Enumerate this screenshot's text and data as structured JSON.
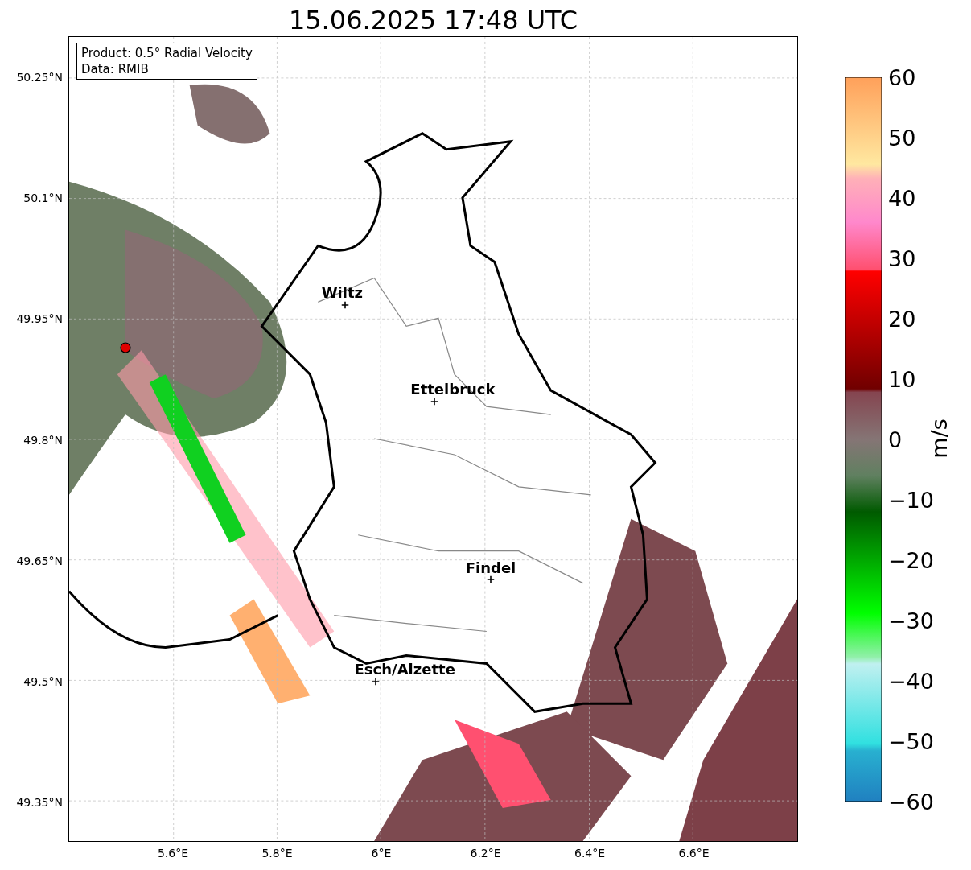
{
  "title": "15.06.2025 17:48 UTC",
  "info_box": {
    "lines": [
      "Product: 0.5° Radial Velocity",
      "Data: RMIB"
    ]
  },
  "map": {
    "cities": [
      {
        "name": "Wiltz"
      },
      {
        "name": "Ettelbruck"
      },
      {
        "name": "Findel"
      },
      {
        "name": "Esch/Alzette"
      }
    ]
  },
  "y_ticks": [
    "50.25°N",
    "50.1°N",
    "49.95°N",
    "49.8°N",
    "49.65°N",
    "49.5°N",
    "49.35°N"
  ],
  "x_ticks": [
    "5.6°E",
    "5.8°E",
    "6°E",
    "6.2°E",
    "6.4°E",
    "6.6°E"
  ],
  "colorbar": {
    "label": "m/s",
    "ticks": [
      "60",
      "50",
      "40",
      "30",
      "20",
      "10",
      "0",
      "−10",
      "−20",
      "−30",
      "−40",
      "−50",
      "−60"
    ]
  }
}
